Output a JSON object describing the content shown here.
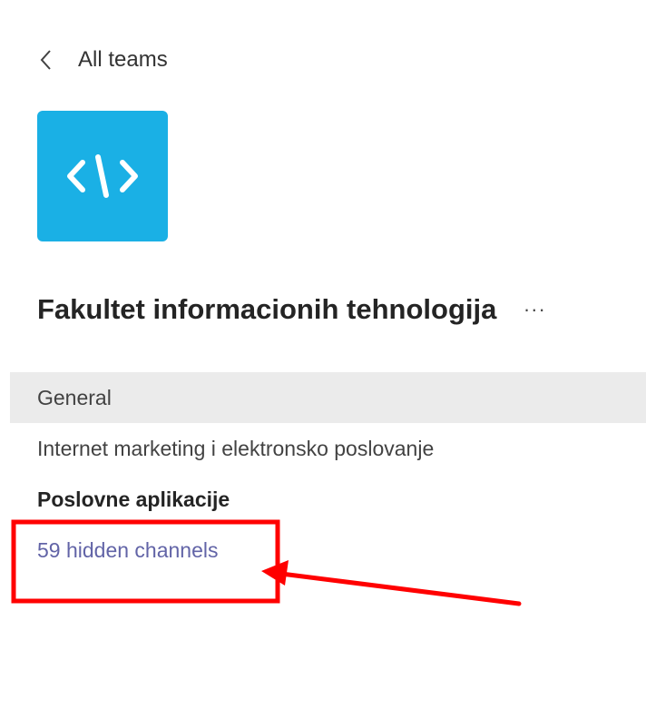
{
  "navigation": {
    "back_label": "All teams"
  },
  "team": {
    "avatar_color": "#1ab0e5",
    "avatar_icon": "code-brackets-icon",
    "name": "Fakultet informacionih tehnologija",
    "more_label": "···"
  },
  "channels": [
    {
      "label": "General",
      "active": true
    },
    {
      "label": "Internet marketing i elektronsko poslovanje"
    },
    {
      "label": "Poslovne aplikacije",
      "bold": true
    }
  ],
  "hidden_channels": {
    "label": "59 hidden channels",
    "color": "#6264a7"
  },
  "annotation": {
    "color": "#ff0000"
  }
}
